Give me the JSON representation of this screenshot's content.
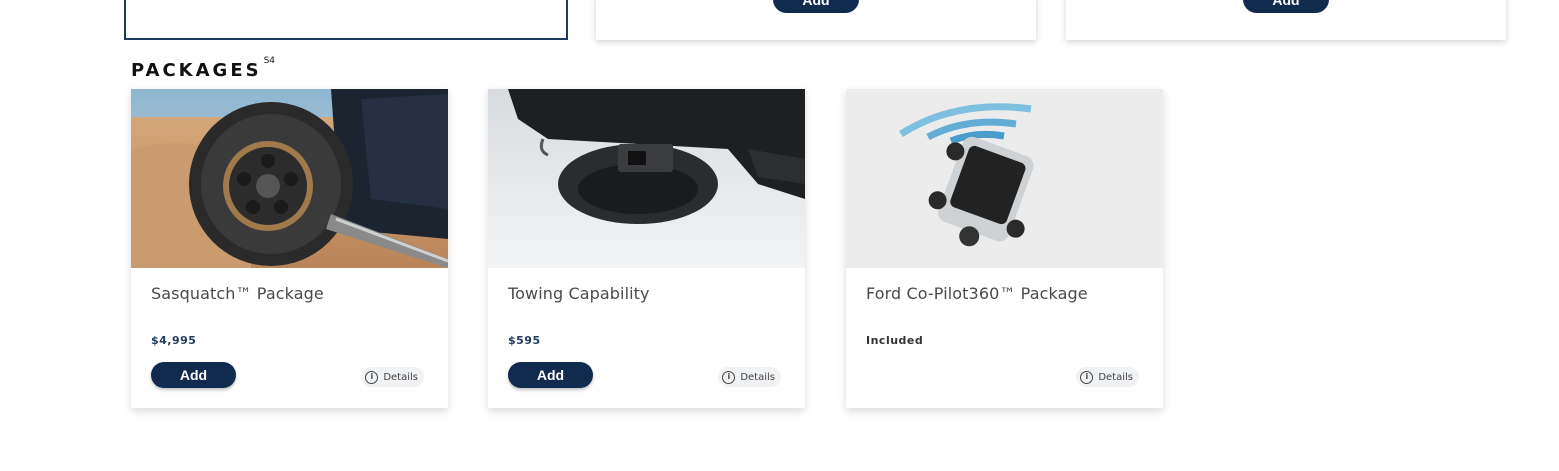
{
  "top_row": {
    "add_label": "Add"
  },
  "section": {
    "title": "PACKAGES",
    "footnote": "S4"
  },
  "packages": [
    {
      "title": "Sasquatch™ Package",
      "price": "$4,995",
      "add_label": "Add",
      "details_label": "Details",
      "image": "tire-wheel-photo"
    },
    {
      "title": "Towing Capability",
      "price": "$595",
      "add_label": "Add",
      "details_label": "Details",
      "image": "tow-hitch-photo"
    },
    {
      "title": "Ford Co-Pilot360™ Package",
      "price": "Included",
      "details_label": "Details",
      "image": "vehicle-sensor-photo"
    }
  ],
  "colors": {
    "accent": "#112b4e",
    "selected_border": "#1e3a5c",
    "price_text": "#223e5e"
  }
}
